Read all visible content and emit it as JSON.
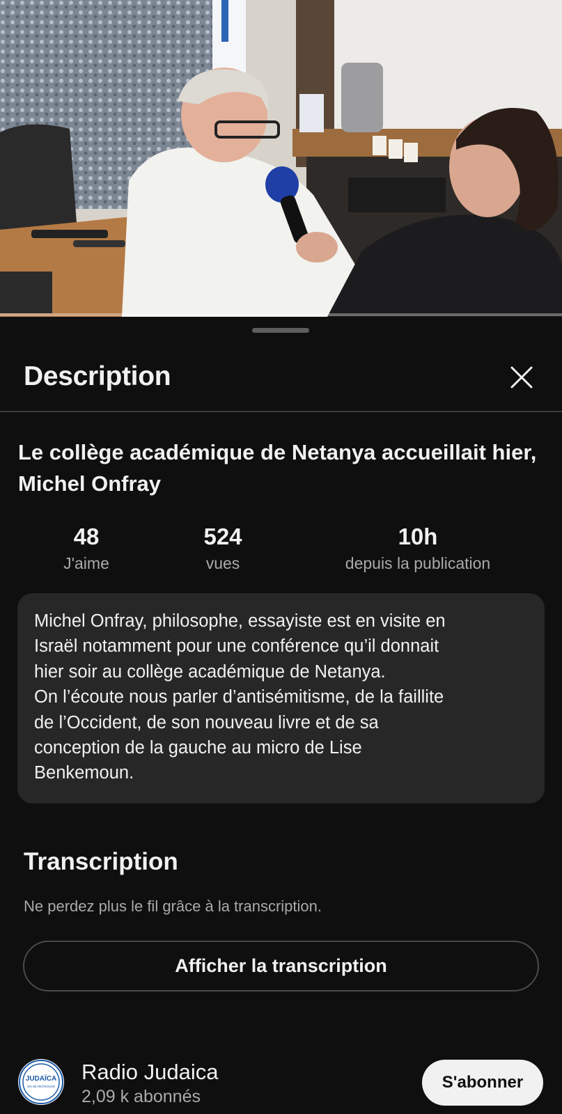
{
  "player": {
    "progress_fraction": 0.0
  },
  "sheet": {
    "title": "Description",
    "close_icon": "close-icon"
  },
  "video": {
    "title": "Le collège académique de Netanya accueillait hier, Michel Onfray"
  },
  "stats": {
    "likes": {
      "value": "48",
      "label": "J'aime"
    },
    "views": {
      "value": "524",
      "label": "vues"
    },
    "age": {
      "value": "10h",
      "label": "depuis la publication"
    }
  },
  "description": {
    "lines": [
      "Michel Onfray, philosophe, essayiste est en visite en",
      "Israël notamment pour une conférence qu’il donnait",
      "hier soir au collège académique de Netanya.",
      "On l’écoute nous parler d’antisémitisme, de la faillite",
      "de l’Occident, de son nouveau livre et de sa",
      "conception de la gauche au micro de Lise",
      "Benkemoun."
    ]
  },
  "transcript": {
    "title": "Transcription",
    "subtitle": "Ne perdez plus le fil grâce à la transcription.",
    "button_label": "Afficher la transcription"
  },
  "channel": {
    "name": "Radio Judaica",
    "subscribers": "2,09 k abonnés",
    "avatar_text": "JUDAÏCA",
    "avatar_subtext": "ON SE RETROUVE",
    "subscribe_label": "S'abonner"
  },
  "colors": {
    "background": "#0f0f0f",
    "card": "#272727",
    "text_primary": "#f1f1f1",
    "text_secondary": "#aaaaaa",
    "progress": "#ff0000"
  }
}
